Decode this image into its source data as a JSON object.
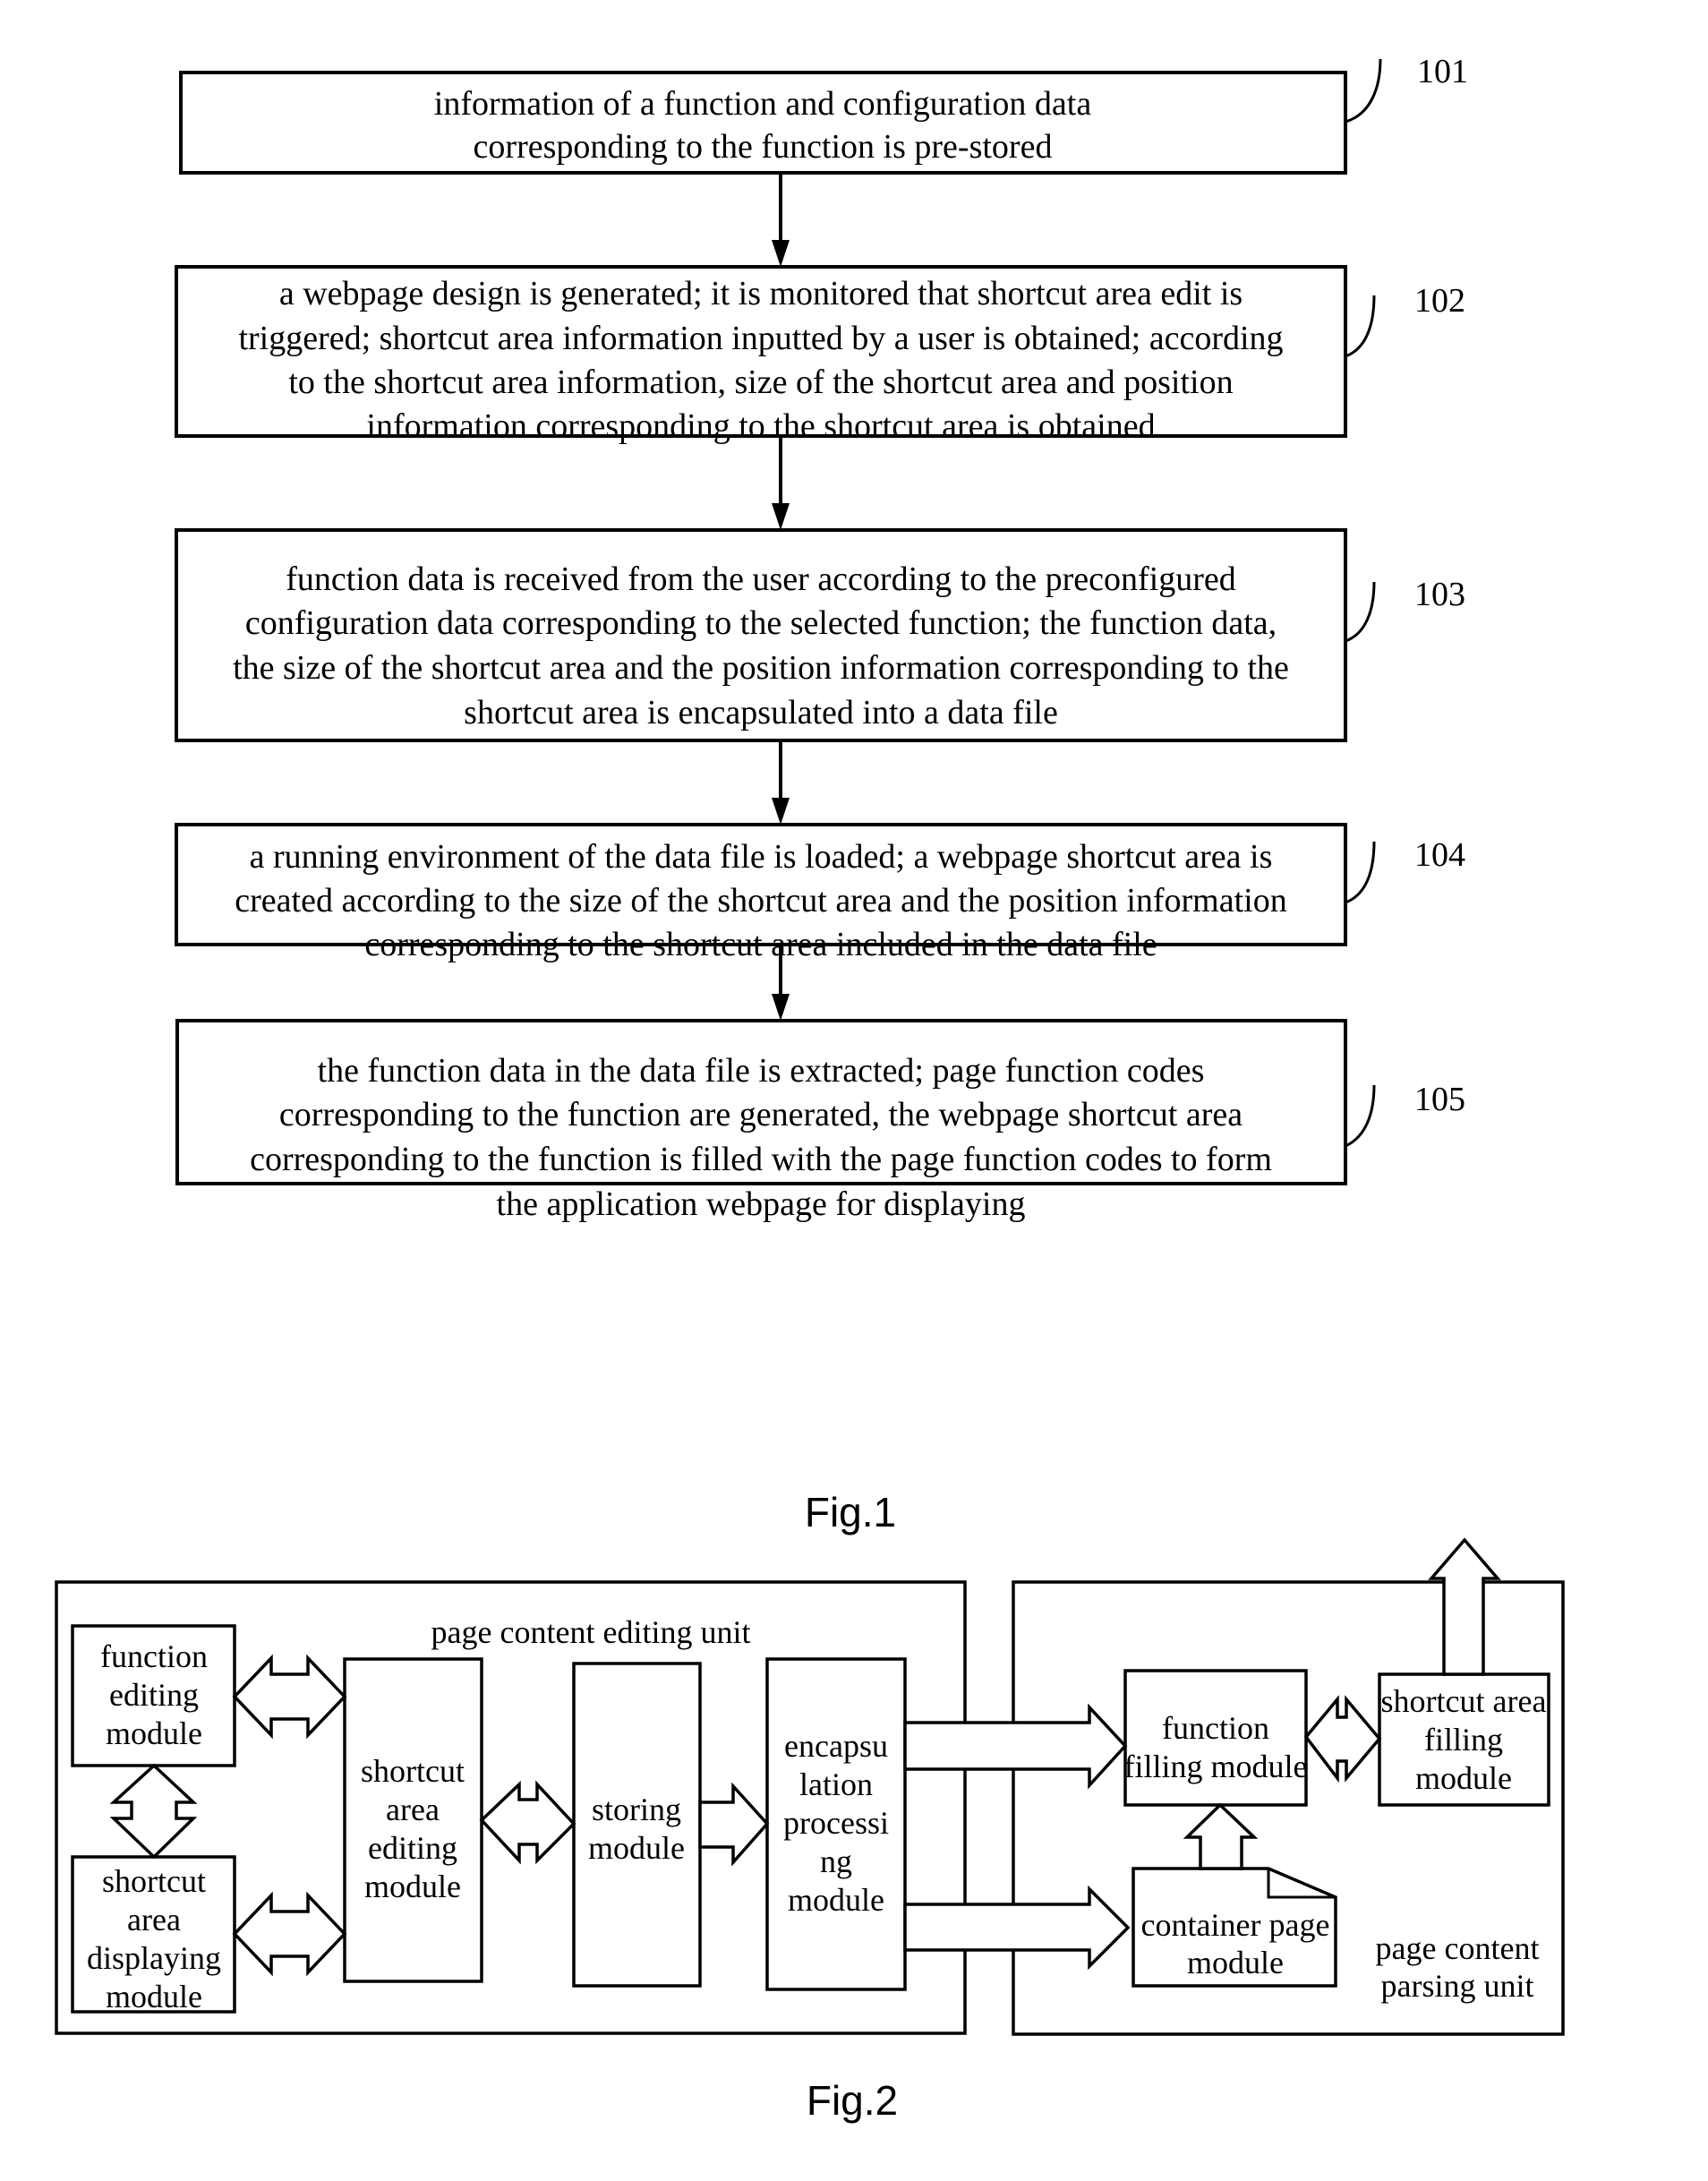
{
  "fig1": {
    "caption": "Fig.1",
    "steps": [
      {
        "ref": "101",
        "lines": [
          "information of a function and configuration data",
          "corresponding to the function is pre-stored"
        ]
      },
      {
        "ref": "102",
        "lines": [
          "a webpage design is generated; it is monitored that shortcut area edit is",
          "triggered; shortcut area information inputted by a user is obtained; according",
          "to the shortcut area information, size of the shortcut area and position",
          "information corresponding to the shortcut area is obtained"
        ]
      },
      {
        "ref": "103",
        "lines": [
          "function data is received from the user according to the preconfigured",
          "configuration data corresponding to the selected function; the function data,",
          "the size of the shortcut area and the position information corresponding to the",
          "shortcut area is encapsulated into a data file"
        ]
      },
      {
        "ref": "104",
        "lines": [
          "a running environment of the data file is loaded; a webpage shortcut area is",
          "created according to the size of the shortcut area and the position information",
          "corresponding to the shortcut area included in the data file"
        ]
      },
      {
        "ref": "105",
        "lines": [
          "the function data in the data file is extracted; page function codes",
          "corresponding to the function are generated, the webpage shortcut area",
          "corresponding to the function is filled with the page function codes to form",
          "the application webpage for displaying"
        ]
      }
    ]
  },
  "fig2": {
    "caption": "Fig.2",
    "editing_unit": {
      "label": "page content editing unit",
      "modules": {
        "function_editing": [
          "function",
          "editing",
          "module"
        ],
        "shortcut_area_displaying": [
          "shortcut",
          "area",
          "displaying",
          "module"
        ],
        "shortcut_area_editing": [
          "shortcut",
          "area",
          "editing",
          "module"
        ],
        "storing": [
          "storing",
          "module"
        ],
        "encapsulation_processing": [
          "encapsu",
          "lation",
          "processi",
          "ng",
          "module"
        ]
      }
    },
    "parsing_unit": {
      "label": [
        "page content",
        "parsing unit"
      ],
      "modules": {
        "function_filling": [
          "function",
          "filling module"
        ],
        "shortcut_area_filling": [
          "shortcut area",
          "filling",
          "module"
        ],
        "container_page": [
          "container page",
          "module"
        ]
      }
    }
  }
}
